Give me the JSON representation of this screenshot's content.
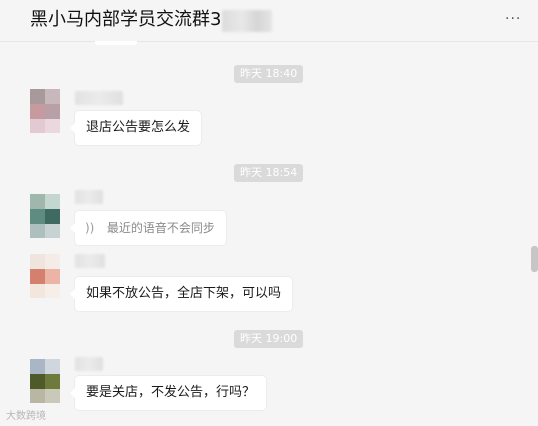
{
  "header": {
    "title": "黑小马内部学员交流群3",
    "more_icon": "more-dots-icon"
  },
  "messages": [
    {
      "time": "昨天 18:40",
      "text": "退店公告要怎么发"
    },
    {
      "time": "昨天 18:54",
      "text": "最近的语音不会同步",
      "kind": "voice",
      "icon": "voice-wave-icon"
    },
    {
      "text": "如果不放公告，全店下架，可以吗"
    },
    {
      "time": "昨天 19:00",
      "text": "要是关店，不发公告，行吗？"
    }
  ],
  "watermark": "大数跨境",
  "colors": {
    "background": "#f5f5f5",
    "bubble": "#ffffff",
    "timestamp_bg": "#dadada"
  }
}
